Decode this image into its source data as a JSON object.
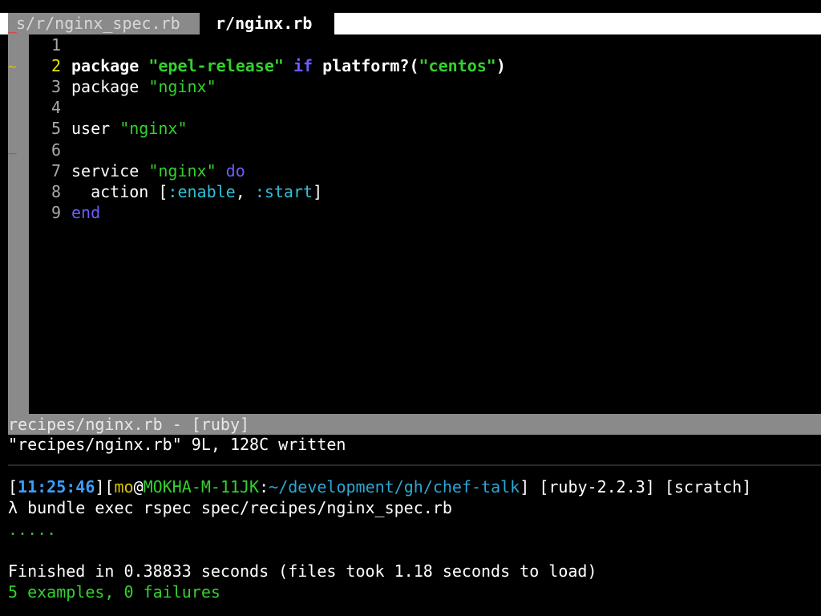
{
  "tabs": [
    {
      "label": "s/r/nginx_spec.rb"
    },
    {
      "label": "r/nginx.rb"
    }
  ],
  "editor": {
    "lines": [
      {
        "number": "1"
      },
      {
        "number": "2"
      },
      {
        "number": "3"
      },
      {
        "number": "4"
      },
      {
        "number": "5"
      },
      {
        "number": "6"
      },
      {
        "number": "7"
      },
      {
        "number": "8"
      },
      {
        "number": "9"
      }
    ],
    "code": {
      "l2": {
        "t1": "package ",
        "t2": "\"epel-release\"",
        "t3": " if ",
        "t4": "platform?(",
        "t5": "\"centos\"",
        "t6": ")"
      },
      "l3": {
        "t1": "package ",
        "t2": "\"nginx\""
      },
      "l5": {
        "t1": "user ",
        "t2": "\"nginx\""
      },
      "l7": {
        "t1": "service ",
        "t2": "\"nginx\"",
        "t3": " do"
      },
      "l8": {
        "t1": "  action [",
        "t2": ":enable",
        "t3": ", ",
        "t4": ":start",
        "t5": "]"
      },
      "l9": {
        "t1": "end"
      }
    },
    "signs": {
      "removed": "‾",
      "changed": "~"
    }
  },
  "statusline": "recipes/nginx.rb - [ruby]",
  "command_message": "\"recipes/nginx.rb\" 9L, 128C written",
  "terminal": {
    "prompt": {
      "open_bracket": "[",
      "time": "11:25:46",
      "mid": "][",
      "user": "mo",
      "at": "@",
      "host": "MOKHA-M-11JK",
      "colon": ":",
      "cwd": "~/development/gh/chef-talk",
      "close": "]",
      "ruby": " [ruby-2.2.3]",
      "branch": " [scratch]"
    },
    "command": "λ bundle exec rspec spec/recipes/nginx_spec.rb",
    "progress": ".....",
    "finished": "Finished in 0.38833 seconds (files took 1.18 seconds to load)",
    "summary": "5 examples, 0 failures"
  },
  "colors": {
    "keyword": "#6a5cff",
    "string": "#34d12e",
    "symbol": "#30c0d8",
    "gutter": "#8a8a8a"
  }
}
